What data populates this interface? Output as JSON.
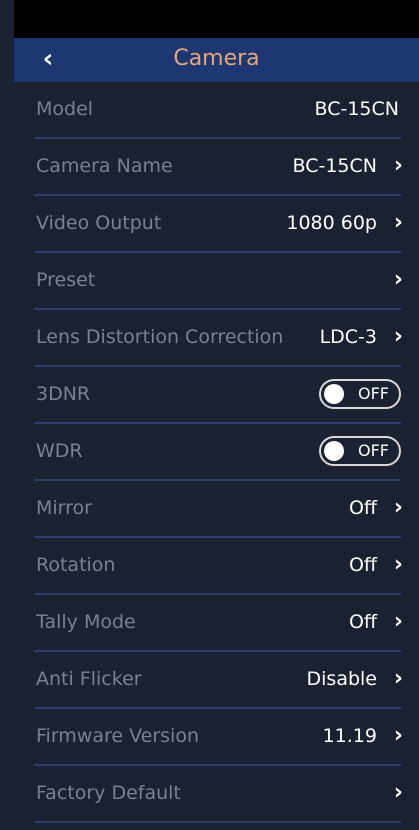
{
  "header": {
    "back_icon": "chevron-left-icon",
    "title": "Camera"
  },
  "rows": [
    {
      "label": "Model",
      "value": "BC-15CN",
      "type": "static"
    },
    {
      "label": "Camera Name",
      "value": "BC-15CN",
      "type": "nav"
    },
    {
      "label": "Video Output",
      "value": "1080 60p",
      "type": "nav"
    },
    {
      "label": "Preset",
      "value": "",
      "type": "nav"
    },
    {
      "label": "Lens Distortion Correction",
      "value": "LDC-3",
      "type": "nav"
    },
    {
      "label": "3DNR",
      "value": "OFF",
      "type": "toggle"
    },
    {
      "label": "WDR",
      "value": "OFF",
      "type": "toggle"
    },
    {
      "label": "Mirror",
      "value": "Off",
      "type": "nav"
    },
    {
      "label": "Rotation",
      "value": "Off",
      "type": "nav"
    },
    {
      "label": "Tally Mode",
      "value": "Off",
      "type": "nav"
    },
    {
      "label": "Anti Flicker",
      "value": "Disable",
      "type": "nav"
    },
    {
      "label": "Firmware Version",
      "value": "11.19",
      "type": "nav"
    },
    {
      "label": "Factory Default",
      "value": "",
      "type": "nav"
    }
  ],
  "colors": {
    "header": "#1d3772",
    "title": "#e4a878",
    "label": "#7a8192",
    "divider": "#28406b"
  }
}
